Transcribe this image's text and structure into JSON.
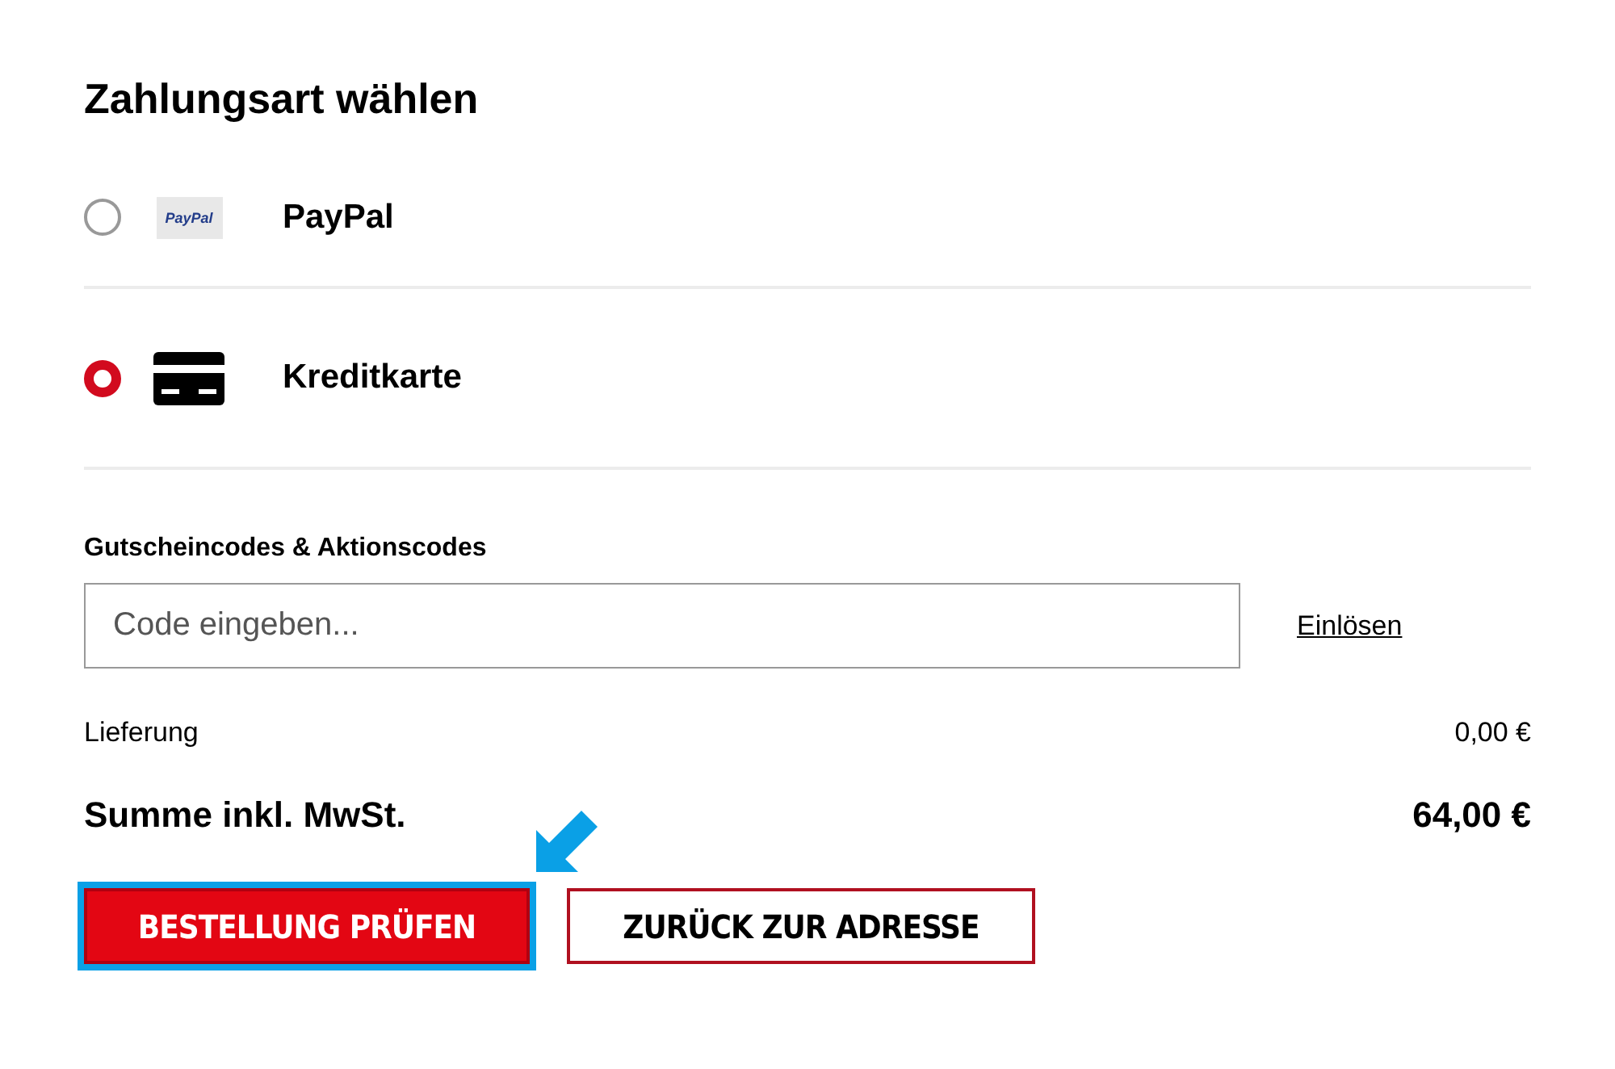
{
  "heading": "Zahlungsart wählen",
  "payment_methods": [
    {
      "kind": "paypal",
      "label": "PayPal",
      "logo_text": "PayPal",
      "selected": false
    },
    {
      "kind": "card",
      "label": "Kreditkarte",
      "selected": true
    }
  ],
  "voucher": {
    "label": "Gutscheincodes & Aktionscodes",
    "placeholder": "Code eingeben...",
    "redeem_link": "Einlösen"
  },
  "totals": [
    {
      "kind": "normal",
      "label": "Lieferung",
      "value": "0,00 €"
    },
    {
      "kind": "total",
      "label": "Summe inkl. MwSt.",
      "value": "64,00 €"
    }
  ],
  "buttons": [
    {
      "kind": "primary",
      "label": "BESTELLUNG PRÜFEN",
      "highlighted": true
    },
    {
      "kind": "secondary",
      "label": "ZURÜCK ZUR ADRESSE",
      "highlighted": false
    }
  ]
}
